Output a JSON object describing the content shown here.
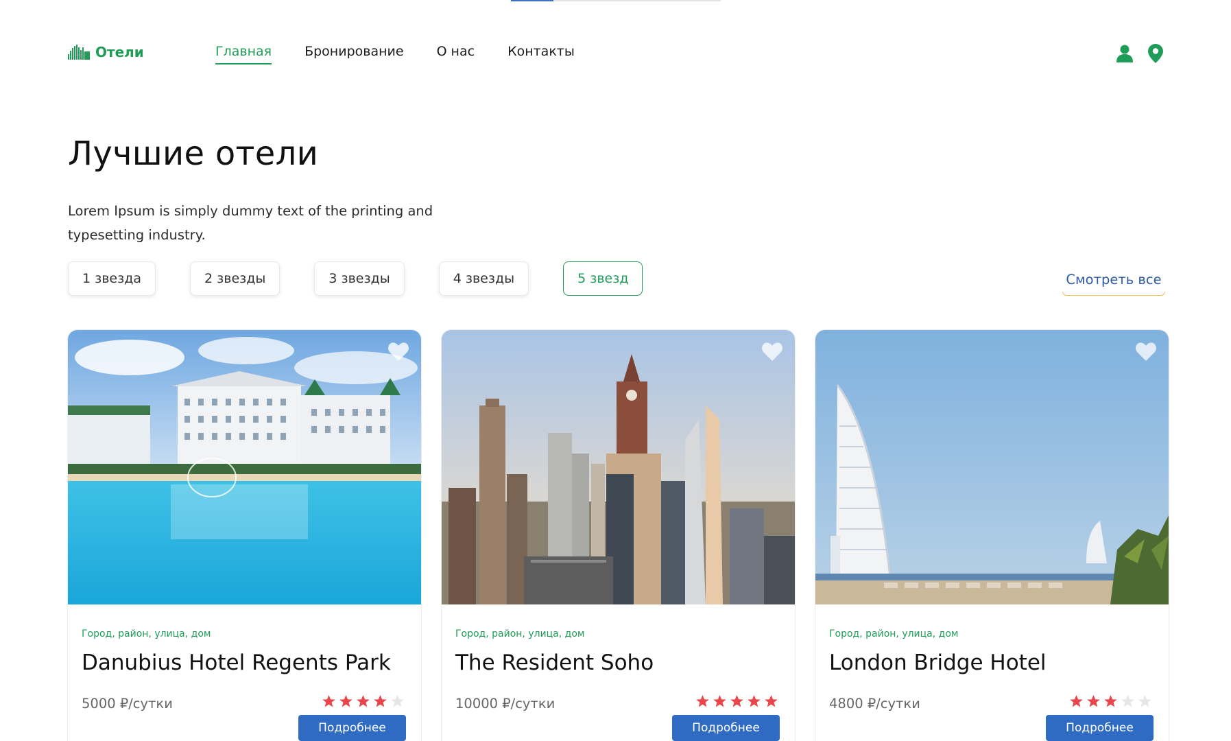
{
  "brand": {
    "name": "Отели",
    "accent": "#1f9d57",
    "link_color": "#2e5aa8",
    "button_color": "#2f6bc3",
    "star_color": "#e9474b"
  },
  "nav": {
    "items": [
      "Главная",
      "Бронирование",
      "О нас",
      "Контакты"
    ],
    "active": "Главная"
  },
  "header_icons": [
    "user-icon",
    "location-pin-icon"
  ],
  "page": {
    "title": "Лучшие отели",
    "lead": "Lorem Ipsum is simply dummy text of the printing and typesetting industry.",
    "see_all": "Смотреть все"
  },
  "filters": {
    "items": [
      "1 звезда",
      "2 звезды",
      "3 звезды",
      "4 звезды",
      "5 звезд"
    ],
    "active": "5 звезд"
  },
  "hotels": [
    {
      "address": "Город, район, улица, дом",
      "name": "Danubius Hotel Regents Park",
      "price": "5000 ₽/сутки",
      "rating": 4,
      "max_rating": 5,
      "button": "Подробнее",
      "image": "resort-pool-photo"
    },
    {
      "address": "Город, район, улица, дом",
      "name": "The Resident Soho",
      "price": "10000 ₽/сутки",
      "rating": 5,
      "max_rating": 5,
      "button": "Подробнее",
      "image": "city-skyline-photo"
    },
    {
      "address": "Город, район, улица, дом",
      "name": "London Bridge Hotel",
      "price": "4800 ₽/сутки",
      "rating": 3,
      "max_rating": 5,
      "button": "Подробнее",
      "image": "sail-tower-photo"
    }
  ]
}
